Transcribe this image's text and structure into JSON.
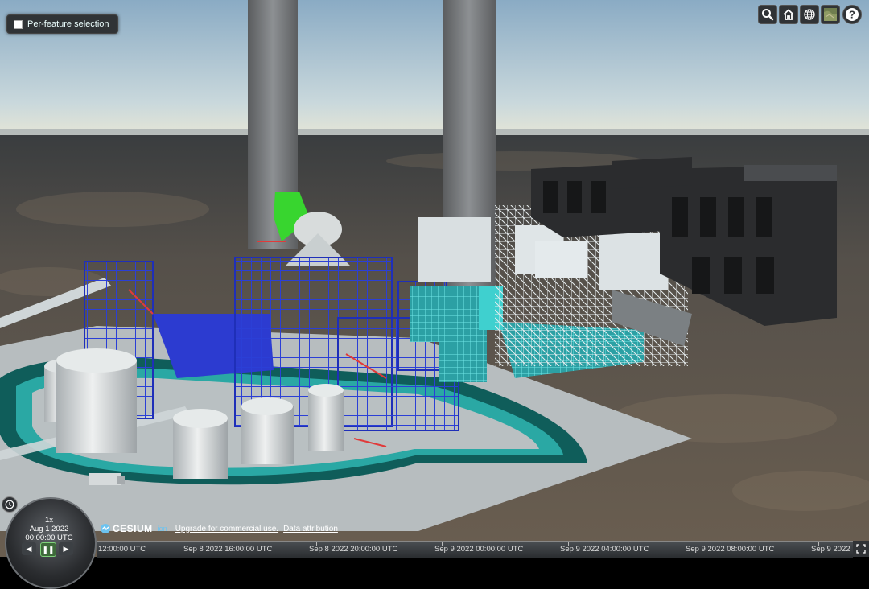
{
  "toolbar": {
    "per_feature_label": "Per-feature selection",
    "buttons": [
      "search-icon",
      "home-icon",
      "globe-icon",
      "imagery-layers-icon",
      "help-icon"
    ]
  },
  "animation": {
    "speed": "1x",
    "date": "Aug 1 2022",
    "time": "00:00:00 UTC",
    "reverse_glyph": "◀",
    "pause_glyph": "❚❚",
    "play_glyph": "▶"
  },
  "credits": {
    "logo": "CESIUM",
    "ion": "ion",
    "upgrade": "Upgrade for commercial use.",
    "attribution": "Data attribution"
  },
  "timeline": {
    "ticks": [
      "12:00:00 UTC",
      "Sep 8 2022 16:00:00 UTC",
      "Sep 8 2022 20:00:00 UTC",
      "Sep 9 2022 00:00:00 UTC",
      "Sep 9 2022 04:00:00 UTC",
      "Sep 9 2022 08:00:00 UTC",
      "Sep 9 2022"
    ]
  },
  "colors": {
    "sky_top": "#8fb0c8",
    "sky_horizon": "#e8e8d8",
    "ground": "#4a4640",
    "pad": "#b9bfc1",
    "structure_blue": "#2436c8",
    "cyan": "#3ec8c8",
    "green_duct": "#36d12e"
  }
}
